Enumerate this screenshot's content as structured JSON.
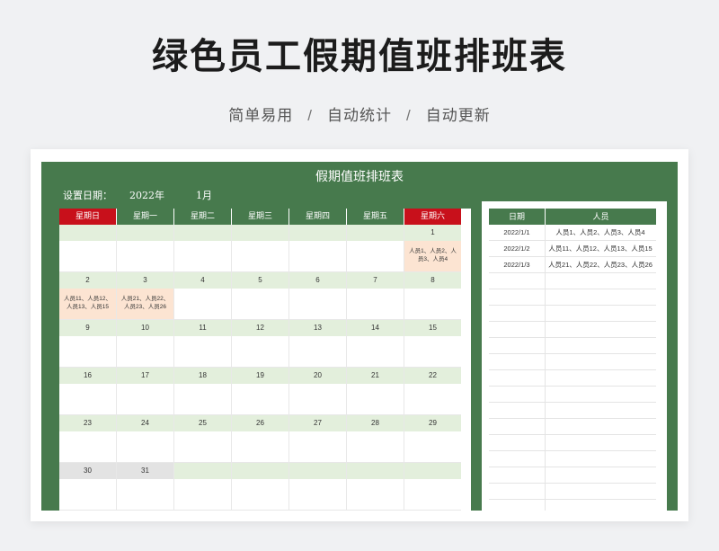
{
  "hero": {
    "title": "绿色员工假期值班排班表",
    "taglines": [
      "简单易用",
      "自动统计",
      "自动更新"
    ],
    "separator": "/"
  },
  "sheet": {
    "title": "假期值班排班表",
    "setting_label": "设置日期：",
    "year": "2022年",
    "month": "1月"
  },
  "calendar": {
    "weekdays": [
      "星期日",
      "星期一",
      "星期二",
      "星期三",
      "星期四",
      "星期五",
      "星期六"
    ],
    "weekday_colors": {
      "weekend": "#c8101b",
      "weekday": "#477a4d"
    },
    "weeks": [
      [
        "",
        "",
        "",
        "",
        "",
        "",
        "1"
      ],
      [
        "2",
        "3",
        "4",
        "5",
        "6",
        "7",
        "8"
      ],
      [
        "9",
        "10",
        "11",
        "12",
        "13",
        "14",
        "15"
      ],
      [
        "16",
        "17",
        "18",
        "19",
        "20",
        "21",
        "22"
      ],
      [
        "23",
        "24",
        "25",
        "26",
        "27",
        "28",
        "29"
      ],
      [
        "30",
        "31",
        "",
        "",
        "",
        "",
        ""
      ]
    ],
    "duty_notes": [
      {
        "week": 0,
        "day": 6,
        "text": "人员1、人员2、人员3、人员4"
      },
      {
        "week": 1,
        "day": 0,
        "text": "人员11、人员12、人员13、人员15"
      },
      {
        "week": 1,
        "day": 1,
        "text": "人员21、人员22、人员23、人员26"
      }
    ]
  },
  "duty_list": {
    "headers": [
      "日期",
      "人员"
    ],
    "rows": [
      {
        "date": "2022/1/1",
        "people": "人员1、人员2、人员3、人员4"
      },
      {
        "date": "2022/1/2",
        "people": "人员11、人员12、人员13、人员15"
      },
      {
        "date": "2022/1/3",
        "people": "人员21、人员22、人员23、人员26"
      }
    ],
    "empty_rows": 15
  }
}
